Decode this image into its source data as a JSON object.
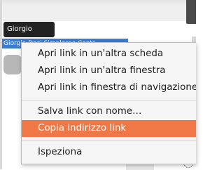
{
  "tooltip": {
    "text": "Giorgio"
  },
  "link_bar": {
    "text": "Giorgio Dosi Simplesso Contr..."
  },
  "context_menu": {
    "items": [
      {
        "label": "Apri link in un'altra scheda"
      },
      {
        "label": "Apri link in un'altra finestra"
      },
      {
        "label": "Apri link in finestra di navigazione"
      },
      {
        "label": "Salva link con nome…"
      },
      {
        "label": "Copia indirizzo link"
      },
      {
        "label": "Ispeziona"
      }
    ],
    "highlight_color": "#f07746"
  }
}
